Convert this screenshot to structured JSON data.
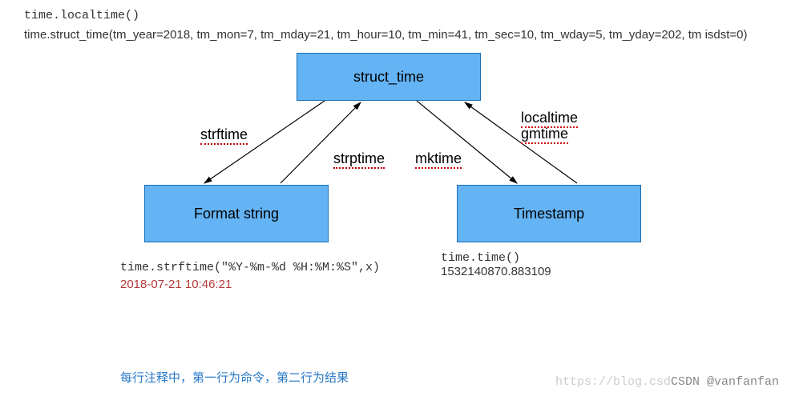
{
  "header": {
    "line1": "time.localtime()",
    "line2": "time.struct_time(tm_year=2018, tm_mon=7, tm_mday=21, tm_hour=10, tm_min=41, tm_sec=10, tm_wday=5, tm_yday=202, tm isdst=0)"
  },
  "diagram": {
    "nodes": {
      "top": "struct_time",
      "left": "Format string",
      "right": "Timestamp"
    },
    "edges": {
      "strftime": "strftime",
      "strptime": "strptime",
      "mktime": "mktime",
      "localtime": "localtime",
      "gmtime": "gmtime"
    }
  },
  "below": {
    "left_code": "time.strftime(\"%Y-%m-%d %H:%M:%S\",x)",
    "left_result": "2018-07-21 10:46:21",
    "right_code": "time.time()",
    "right_result": "1532140870.883109"
  },
  "footnote": "每行注释中，第一行为命令，第二行为结果",
  "watermark_light": "https://blog.csd",
  "watermark_dark": "CSDN @vanfanfan"
}
